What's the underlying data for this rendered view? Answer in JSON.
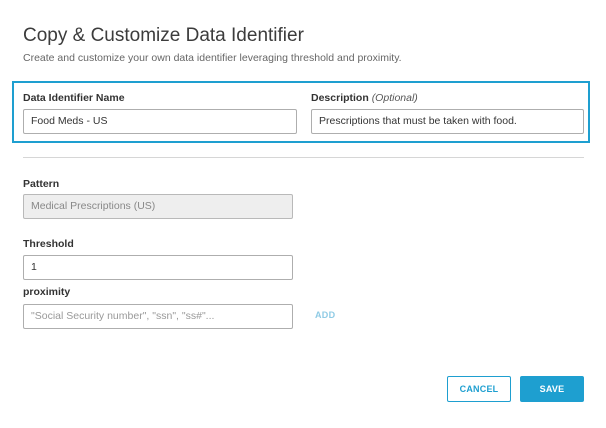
{
  "dialog": {
    "title": "Copy & Customize Data Identifier",
    "subtitle": "Create and customize your own data identifier leveraging threshold and proximity."
  },
  "form": {
    "name": {
      "label": "Data Identifier Name",
      "value": "Food Meds - US"
    },
    "description": {
      "label": "Description",
      "optional": "(Optional)",
      "value": "Prescriptions that must be taken with food."
    },
    "pattern": {
      "label": "Pattern",
      "value": "Medical Prescriptions (US)"
    },
    "threshold": {
      "label": "Threshold",
      "value": "1"
    },
    "proximity": {
      "label": "proximity",
      "placeholder": "\"Social Security number\", \"ssn\", \"ss#\"...",
      "add_label": "ADD"
    }
  },
  "actions": {
    "cancel_label": "CANCEL",
    "save_label": "SAVE"
  },
  "colors": {
    "accent": "#1e9fd0",
    "add_link": "#8fcbe5",
    "disabled_bg": "#eeeeee"
  }
}
